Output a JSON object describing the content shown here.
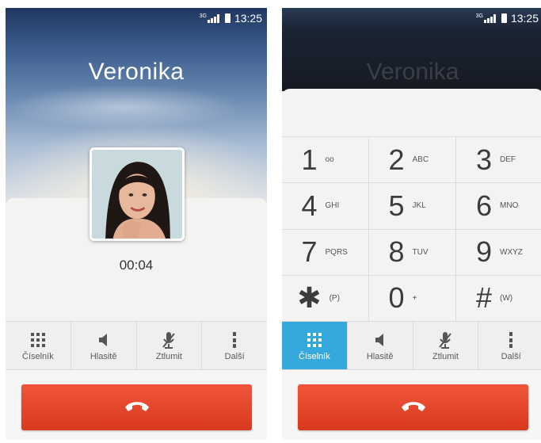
{
  "status": {
    "network": "3G",
    "time": "13:25"
  },
  "caller": {
    "name": "Veronika",
    "duration": "00:04"
  },
  "actions": [
    {
      "label": "Číselník"
    },
    {
      "label": "Hlasitě"
    },
    {
      "label": "Ztlumit"
    },
    {
      "label": "Další"
    }
  ],
  "dialpad": {
    "keys": [
      {
        "digit": "1",
        "letters": "oo"
      },
      {
        "digit": "2",
        "letters": "ABC"
      },
      {
        "digit": "3",
        "letters": "DEF"
      },
      {
        "digit": "4",
        "letters": "GHI"
      },
      {
        "digit": "5",
        "letters": "JKL"
      },
      {
        "digit": "6",
        "letters": "MNO"
      },
      {
        "digit": "7",
        "letters": "PQRS"
      },
      {
        "digit": "8",
        "letters": "TUV"
      },
      {
        "digit": "9",
        "letters": "WXYZ"
      },
      {
        "digit": "✱",
        "letters": "(P)"
      },
      {
        "digit": "0",
        "letters": "+"
      },
      {
        "digit": "#",
        "letters": "(W)"
      }
    ]
  },
  "colors": {
    "accent": "#35a9dc",
    "end_call": "#e2452b"
  },
  "icons": {
    "dialpad": "dialpad-grid-icon",
    "speaker": "speaker-icon",
    "mute": "mic-mute-icon",
    "more": "more-vertical-icon",
    "end_call": "phone-hangup-icon"
  }
}
